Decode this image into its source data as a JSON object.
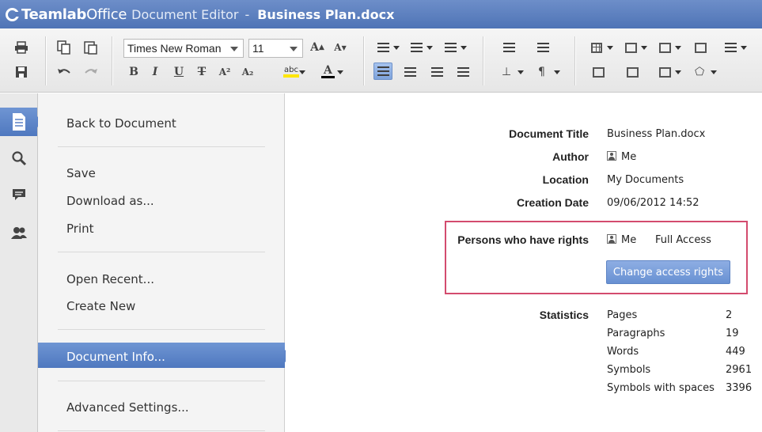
{
  "titlebar": {
    "brand_bold": "Teamlab",
    "brand_light": "Office",
    "app_name": "Document Editor",
    "separator": "-",
    "doc_name": "Business Plan.docx"
  },
  "toolbar": {
    "font_name": "Times New Roman",
    "font_size": "11",
    "bold": "B",
    "italic": "I",
    "underline": "U",
    "strikethrough": "T",
    "superscript": "A²",
    "subscript": "A₂",
    "highlight_label": "abc",
    "font_color_label": "A",
    "increase_size": "A",
    "decrease_size": "A",
    "highlight_color": "#ffe600",
    "font_color": "#000000"
  },
  "rail": {
    "items": [
      "file-icon",
      "search-icon",
      "comment-icon",
      "users-icon"
    ]
  },
  "menu": {
    "back": "Back to Document",
    "save": "Save",
    "download": "Download as...",
    "print": "Print",
    "open_recent": "Open Recent...",
    "create_new": "Create New",
    "document_info": "Document Info...",
    "advanced_settings": "Advanced Settings..."
  },
  "info": {
    "title_label": "Document Title",
    "title_value": "Business Plan.docx",
    "author_label": "Author",
    "author_value": "Me",
    "location_label": "Location",
    "location_value": "My Documents",
    "creation_label": "Creation Date",
    "creation_value": "09/06/2012 14:52",
    "rights_label": "Persons who have rights",
    "rights_person": "Me",
    "rights_access": "Full Access",
    "change_rights_button": "Change access rights",
    "statistics_label": "Statistics",
    "stats": [
      {
        "name": "Pages",
        "value": "2"
      },
      {
        "name": "Paragraphs",
        "value": "19"
      },
      {
        "name": "Words",
        "value": "449"
      },
      {
        "name": "Symbols",
        "value": "2961"
      },
      {
        "name": "Symbols with spaces",
        "value": "3396"
      }
    ]
  },
  "colors": {
    "accent": "#5a81c6",
    "highlight_box": "#d34b6e"
  }
}
